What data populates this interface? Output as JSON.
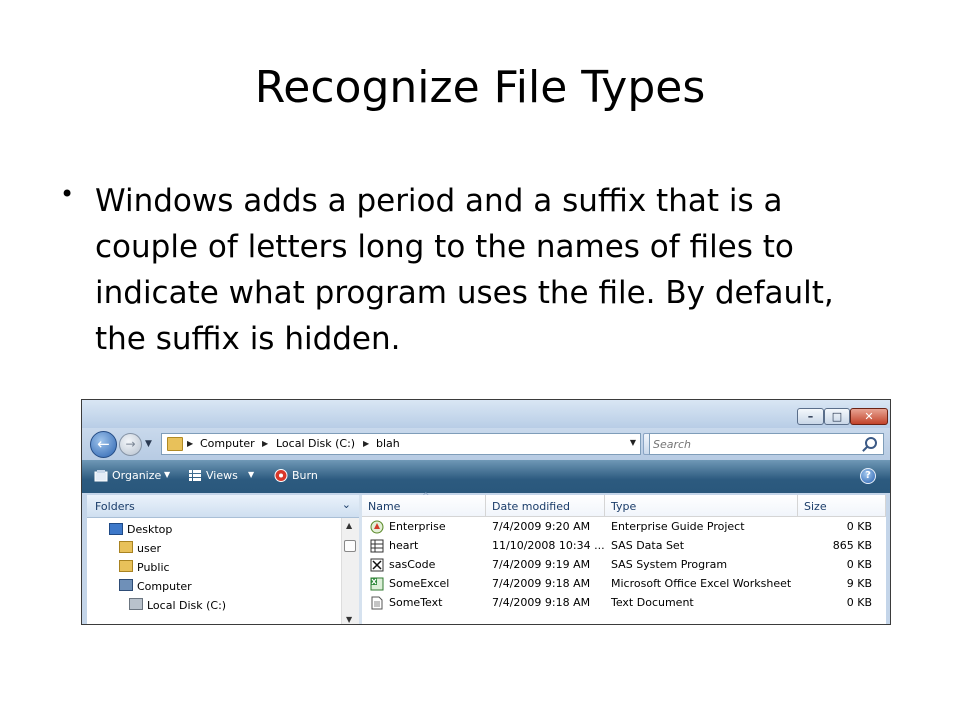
{
  "slide": {
    "title": "Recognize File Types",
    "bullet": "Windows adds a period and a suffix  that is a couple of letters long to the names of files to indicate what program uses the file. By default, the suffix is hidden."
  },
  "window": {
    "controls": {
      "minimize": "–",
      "maximize": "□",
      "close": "✕"
    },
    "breadcrumb": [
      "Computer",
      "Local Disk (C:)",
      "blah"
    ],
    "search": {
      "placeholder": "Search"
    },
    "toolbar": {
      "organize": "Organize",
      "views": "Views",
      "burn": "Burn"
    },
    "folders": {
      "header": "Folders",
      "items": [
        {
          "label": "Desktop",
          "icon": "desktop-icon"
        },
        {
          "label": "user",
          "icon": "user-folder-icon"
        },
        {
          "label": "Public",
          "icon": "folder-icon"
        },
        {
          "label": "Computer",
          "icon": "computer-icon"
        },
        {
          "label": "Local Disk (C:)",
          "icon": "drive-icon"
        }
      ]
    },
    "files": {
      "columns": [
        "Name",
        "Date modified",
        "Type",
        "Size"
      ],
      "rows": [
        {
          "name": "Enterprise",
          "date": "7/4/2009 9:20 AM",
          "type": "Enterprise Guide Project",
          "size": "0 KB",
          "icon": "enterprise-guide-icon"
        },
        {
          "name": "heart",
          "date": "11/10/2008 10:34 ...",
          "type": "SAS Data Set",
          "size": "865 KB",
          "icon": "sas-dataset-icon"
        },
        {
          "name": "sasCode",
          "date": "7/4/2009 9:19 AM",
          "type": "SAS System Program",
          "size": "0 KB",
          "icon": "sas-program-icon"
        },
        {
          "name": "SomeExcel",
          "date": "7/4/2009 9:18 AM",
          "type": "Microsoft Office Excel Worksheet",
          "size": "9 KB",
          "icon": "excel-icon"
        },
        {
          "name": "SomeText",
          "date": "7/4/2009 9:18 AM",
          "type": "Text Document",
          "size": "0 KB",
          "icon": "text-document-icon"
        }
      ]
    }
  }
}
